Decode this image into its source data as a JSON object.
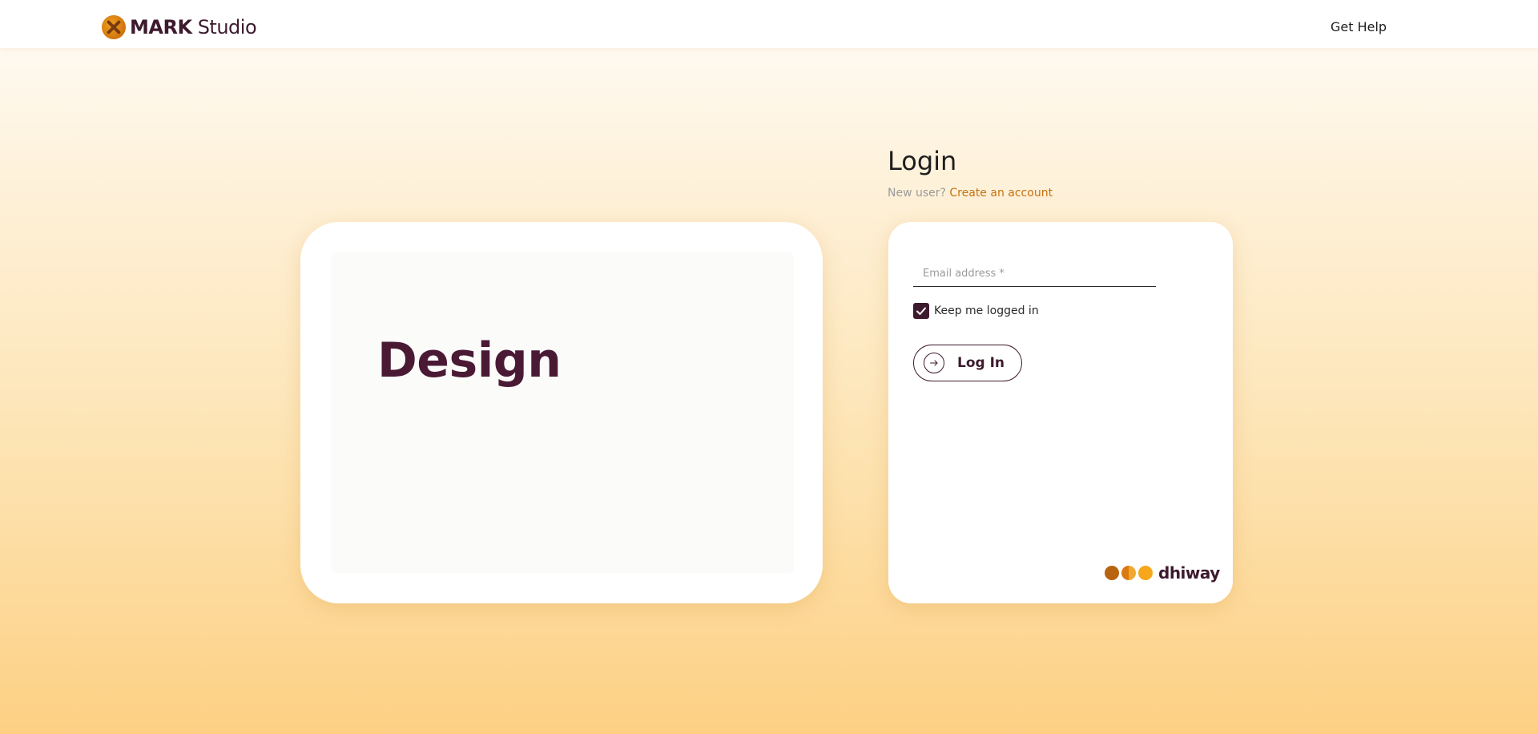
{
  "header": {
    "brand_bold": "MARK",
    "brand_light": "Studio",
    "help_link": "Get Help"
  },
  "showcase": {
    "title": "Design"
  },
  "login": {
    "title": "Login",
    "new_user_prefix": "New user?",
    "create_account_link": "Create an account",
    "email_placeholder": "Email address *",
    "email_value": "",
    "keep_logged_in_label": "Keep me logged in",
    "keep_logged_in_checked": true,
    "login_button": "Log In"
  },
  "footer_logo": {
    "text": "dhiway"
  },
  "colors": {
    "brand_primary": "#3d1a2e",
    "accent_orange": "#c7700f",
    "gradient_top": "#fffdf9",
    "gradient_bottom": "#fdd084"
  },
  "icons": {
    "brand": "mark-studio-logo-icon",
    "checkbox": "checkmark-icon",
    "login_button": "arrow-right-circle-icon"
  }
}
